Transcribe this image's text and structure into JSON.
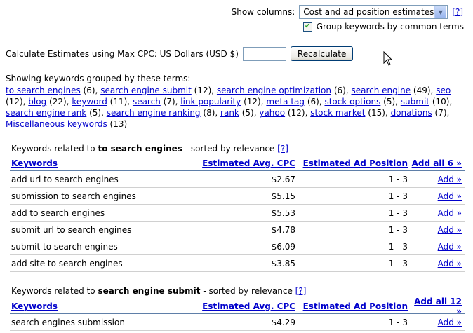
{
  "controls": {
    "show_columns_label": "Show columns:",
    "show_columns_value": "Cost and ad position estimates",
    "help": "[?]",
    "group_keywords_label": "Group keywords by common terms",
    "group_keywords_checked": true,
    "calc_label": "Calculate Estimates using Max CPC: US Dollars (USD $)",
    "max_cpc_value": "",
    "recalculate_label": "Recalculate"
  },
  "grouped_heading": "Showing keywords grouped by these terms:",
  "terms": [
    {
      "term": "to search engines",
      "count": "(6)"
    },
    {
      "term": "search engine submit",
      "count": "(12)"
    },
    {
      "term": "search engine optimization",
      "count": "(6)"
    },
    {
      "term": "search engine",
      "count": "(49)"
    },
    {
      "term": "seo",
      "count": "(12)"
    },
    {
      "term": "blog",
      "count": "(22)"
    },
    {
      "term": "keyword",
      "count": "(11)"
    },
    {
      "term": "search",
      "count": "(7)"
    },
    {
      "term": "link popularity",
      "count": "(12)"
    },
    {
      "term": "meta tag",
      "count": "(6)"
    },
    {
      "term": "stock options",
      "count": "(5)"
    },
    {
      "term": "submit",
      "count": "(10)"
    },
    {
      "term": "search engine rank",
      "count": "(5)"
    },
    {
      "term": "search engine ranking",
      "count": "(8)"
    },
    {
      "term": "rank",
      "count": "(5)"
    },
    {
      "term": "yahoo",
      "count": "(12)"
    },
    {
      "term": "stock market",
      "count": "(15)"
    },
    {
      "term": "donations",
      "count": "(7)"
    },
    {
      "term": "Miscellaneous keywords",
      "count": "(13)"
    }
  ],
  "columns": {
    "keywords": "Keywords",
    "cpc": "Estimated Avg. CPC",
    "position": "Estimated Ad Position"
  },
  "sections": [
    {
      "prefix": "Keywords related to",
      "term": "to search engines",
      "suffix": "- sorted by relevance",
      "help": "[?]",
      "add_all": "Add all 6 »",
      "rows": [
        {
          "keyword": "add url to search engines",
          "cpc": "$2.67",
          "position": "1 - 3",
          "add": "Add »"
        },
        {
          "keyword": "submission to search engines",
          "cpc": "$5.15",
          "position": "1 - 3",
          "add": "Add »"
        },
        {
          "keyword": "add to search engines",
          "cpc": "$5.53",
          "position": "1 - 3",
          "add": "Add »"
        },
        {
          "keyword": "submit url to search engines",
          "cpc": "$4.78",
          "position": "1 - 3",
          "add": "Add »"
        },
        {
          "keyword": "submit to search engines",
          "cpc": "$6.09",
          "position": "1 - 3",
          "add": "Add »"
        },
        {
          "keyword": "add site to search engines",
          "cpc": "$3.85",
          "position": "1 - 3",
          "add": "Add »"
        }
      ]
    },
    {
      "prefix": "Keywords related to",
      "term": "search engine submit",
      "suffix": "- sorted by relevance",
      "help": "[?]",
      "add_all": "Add all 12 »",
      "rows": [
        {
          "keyword": "search engines submission",
          "cpc": "$4.29",
          "position": "1 - 3",
          "add": "Add »"
        }
      ]
    }
  ]
}
